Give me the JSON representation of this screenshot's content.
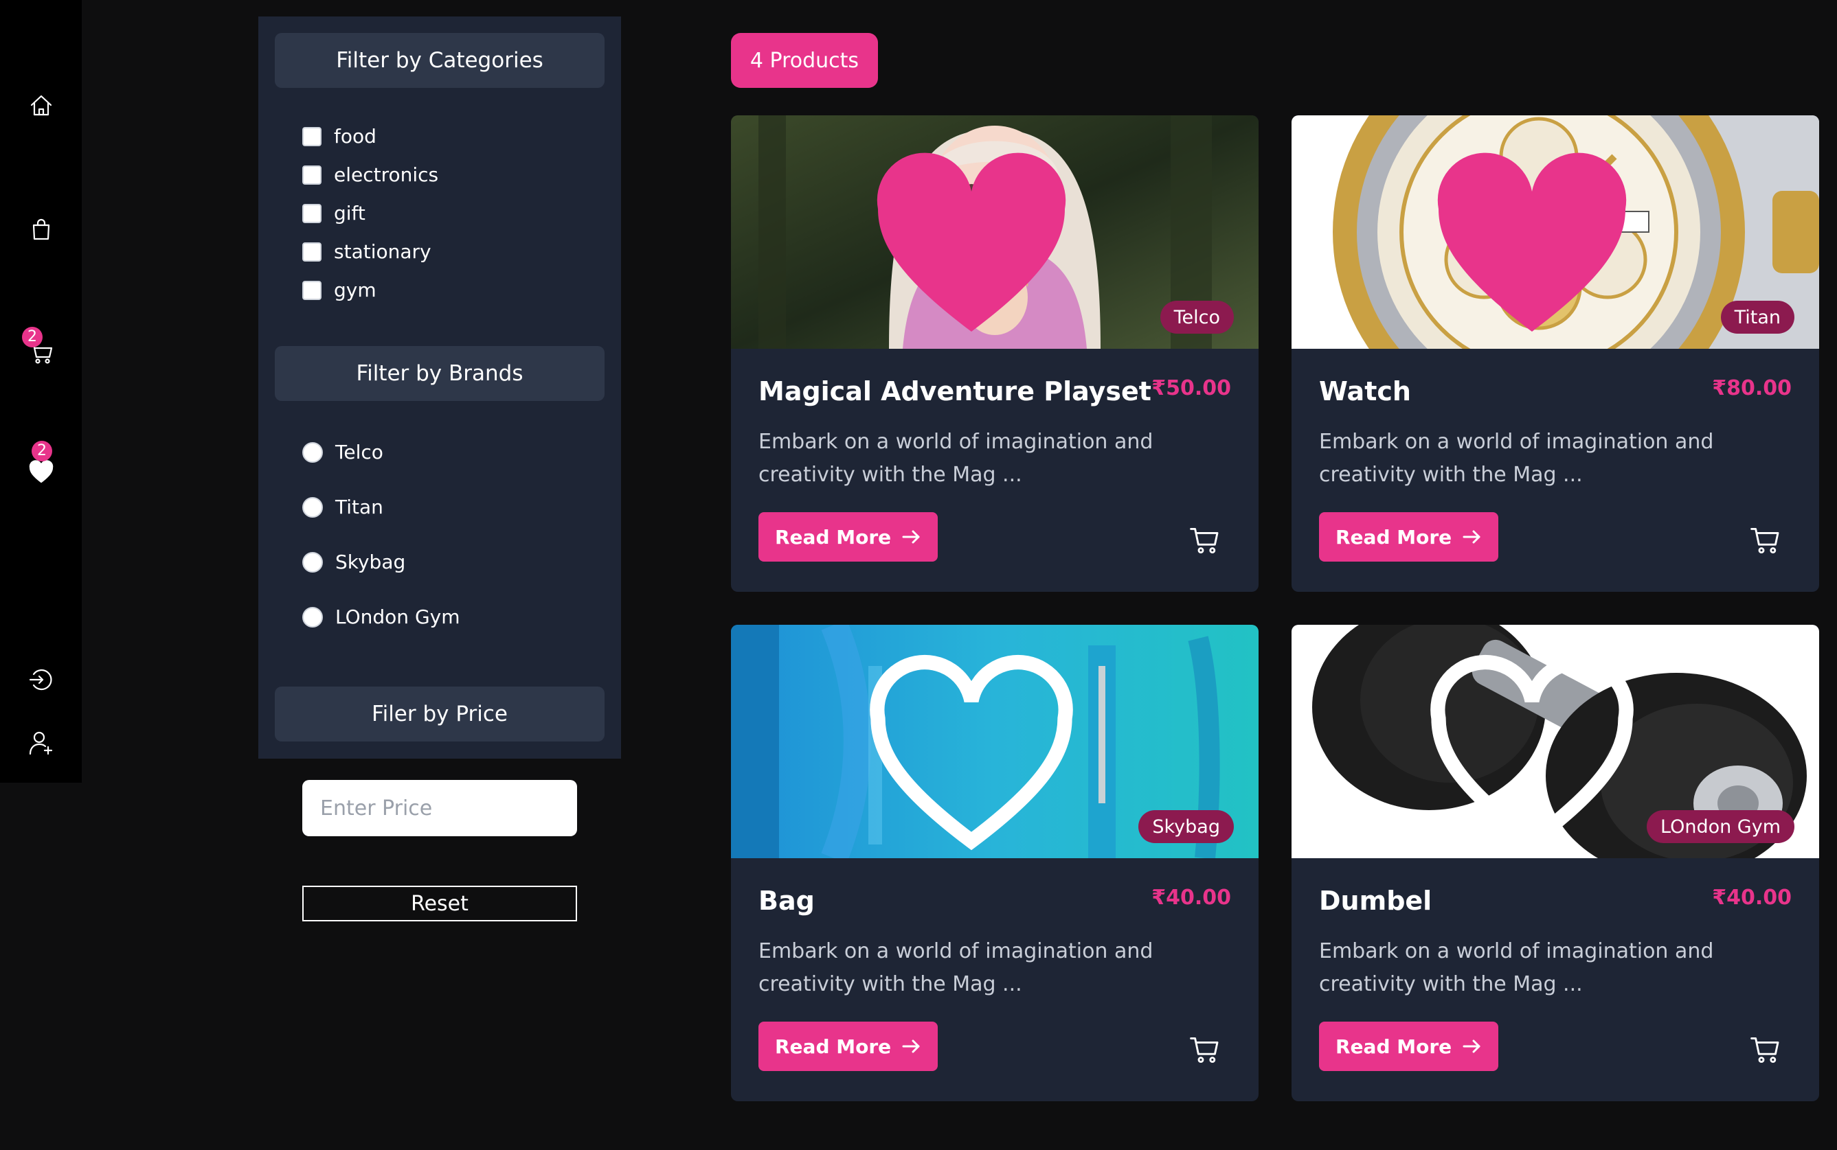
{
  "nav": {
    "items": [
      {
        "icon": "home-icon"
      },
      {
        "icon": "shopping-bag-icon"
      },
      {
        "icon": "cart-icon",
        "badge": "2"
      },
      {
        "icon": "heart-icon",
        "badge": "2"
      },
      {
        "icon": "login-icon"
      },
      {
        "icon": "add-user-icon"
      }
    ]
  },
  "filters": {
    "categories_title": "Filter by Categories",
    "categories": [
      "food",
      "electronics",
      "gift",
      "stationary",
      "gym"
    ],
    "brands_title": "Filter by Brands",
    "brands": [
      "Telco",
      "Titan",
      "Skybag",
      "LOndon Gym"
    ],
    "price_title": "Filer by Price",
    "price_placeholder": "Enter Price",
    "reset_label": "Reset"
  },
  "products_count": "4 Products",
  "products": [
    {
      "title": "Magical Adventure Playset",
      "price": "₹50.00",
      "brand": "Telco",
      "description": "Embark on a world of imagination and creativity with the Mag ...",
      "read_more": "Read More",
      "favorited": true
    },
    {
      "title": "Watch",
      "price": "₹80.00",
      "brand": "Titan",
      "description": "Embark on a world of imagination and creativity with the Mag ...",
      "read_more": "Read More",
      "favorited": true
    },
    {
      "title": "Bag",
      "price": "₹40.00",
      "brand": "Skybag",
      "description": "Embark on a world of imagination and creativity with the Mag ...",
      "read_more": "Read More",
      "favorited": false
    },
    {
      "title": "Dumbel",
      "price": "₹40.00",
      "brand": "LOndon Gym",
      "description": "Embark on a world of imagination and creativity with the Mag ...",
      "read_more": "Read More",
      "favorited": false
    }
  ],
  "colors": {
    "accent": "#e8348b",
    "panel": "#1e2535",
    "background": "#0e0e0f"
  }
}
